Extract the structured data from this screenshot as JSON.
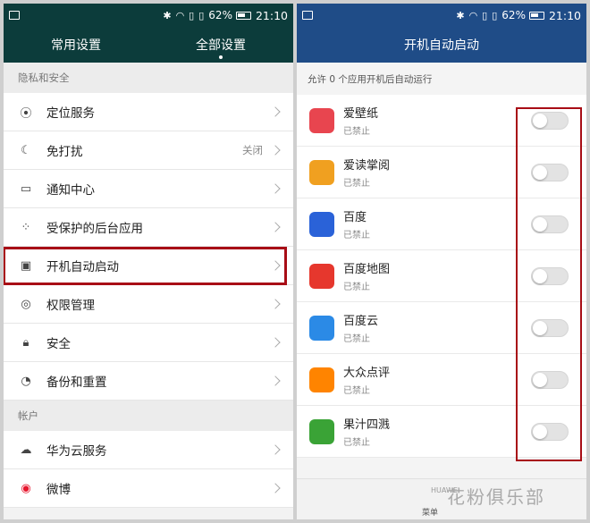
{
  "left": {
    "status": {
      "battery": "62%",
      "time": "21:10"
    },
    "tabs": [
      "常用设置",
      "全部设置"
    ],
    "sections": [
      {
        "title": "隐私和安全",
        "items": [
          {
            "icon": "location-icon",
            "label": "定位服务",
            "value": ""
          },
          {
            "icon": "moon-icon",
            "label": "免打扰",
            "value": "关闭"
          },
          {
            "icon": "notification-icon",
            "label": "通知中心",
            "value": ""
          },
          {
            "icon": "apps-icon",
            "label": "受保护的后台应用",
            "value": ""
          },
          {
            "icon": "startup-icon",
            "label": "开机自动启动",
            "value": ""
          },
          {
            "icon": "permission-icon",
            "label": "权限管理",
            "value": ""
          },
          {
            "icon": "lock-icon",
            "label": "安全",
            "value": ""
          },
          {
            "icon": "backup-icon",
            "label": "备份和重置",
            "value": ""
          }
        ]
      },
      {
        "title": "帐户",
        "items": [
          {
            "icon": "cloud-icon",
            "label": "华为云服务",
            "value": ""
          },
          {
            "icon": "weibo-icon",
            "label": "微博",
            "value": ""
          }
        ]
      }
    ]
  },
  "right": {
    "status": {
      "battery": "62%",
      "time": "21:10"
    },
    "title": "开机自动启动",
    "subtitle": "允许 0 个应用开机后自动运行",
    "apps": [
      {
        "name": "爱壁纸",
        "status": "已禁止",
        "icon": "aibizhi-icon",
        "color": "#e8454f"
      },
      {
        "name": "爱读掌阅",
        "status": "已禁止",
        "icon": "ireader-icon",
        "color": "#f0a020"
      },
      {
        "name": "百度",
        "status": "已禁止",
        "icon": "baidu-icon",
        "color": "#2a62d8"
      },
      {
        "name": "百度地图",
        "status": "已禁止",
        "icon": "baidu-map-icon",
        "color": "#e6372d"
      },
      {
        "name": "百度云",
        "status": "已禁止",
        "icon": "baidu-cloud-icon",
        "color": "#2b8ae6"
      },
      {
        "name": "大众点评",
        "status": "已禁止",
        "icon": "dianping-icon",
        "color": "#ff8400"
      },
      {
        "name": "果汁四溅",
        "status": "已禁止",
        "icon": "fruit-game-icon",
        "color": "#3aa336"
      }
    ],
    "menu": "菜单",
    "watermark": "花粉俱乐部",
    "watermark_brand": "HUAWEI"
  }
}
